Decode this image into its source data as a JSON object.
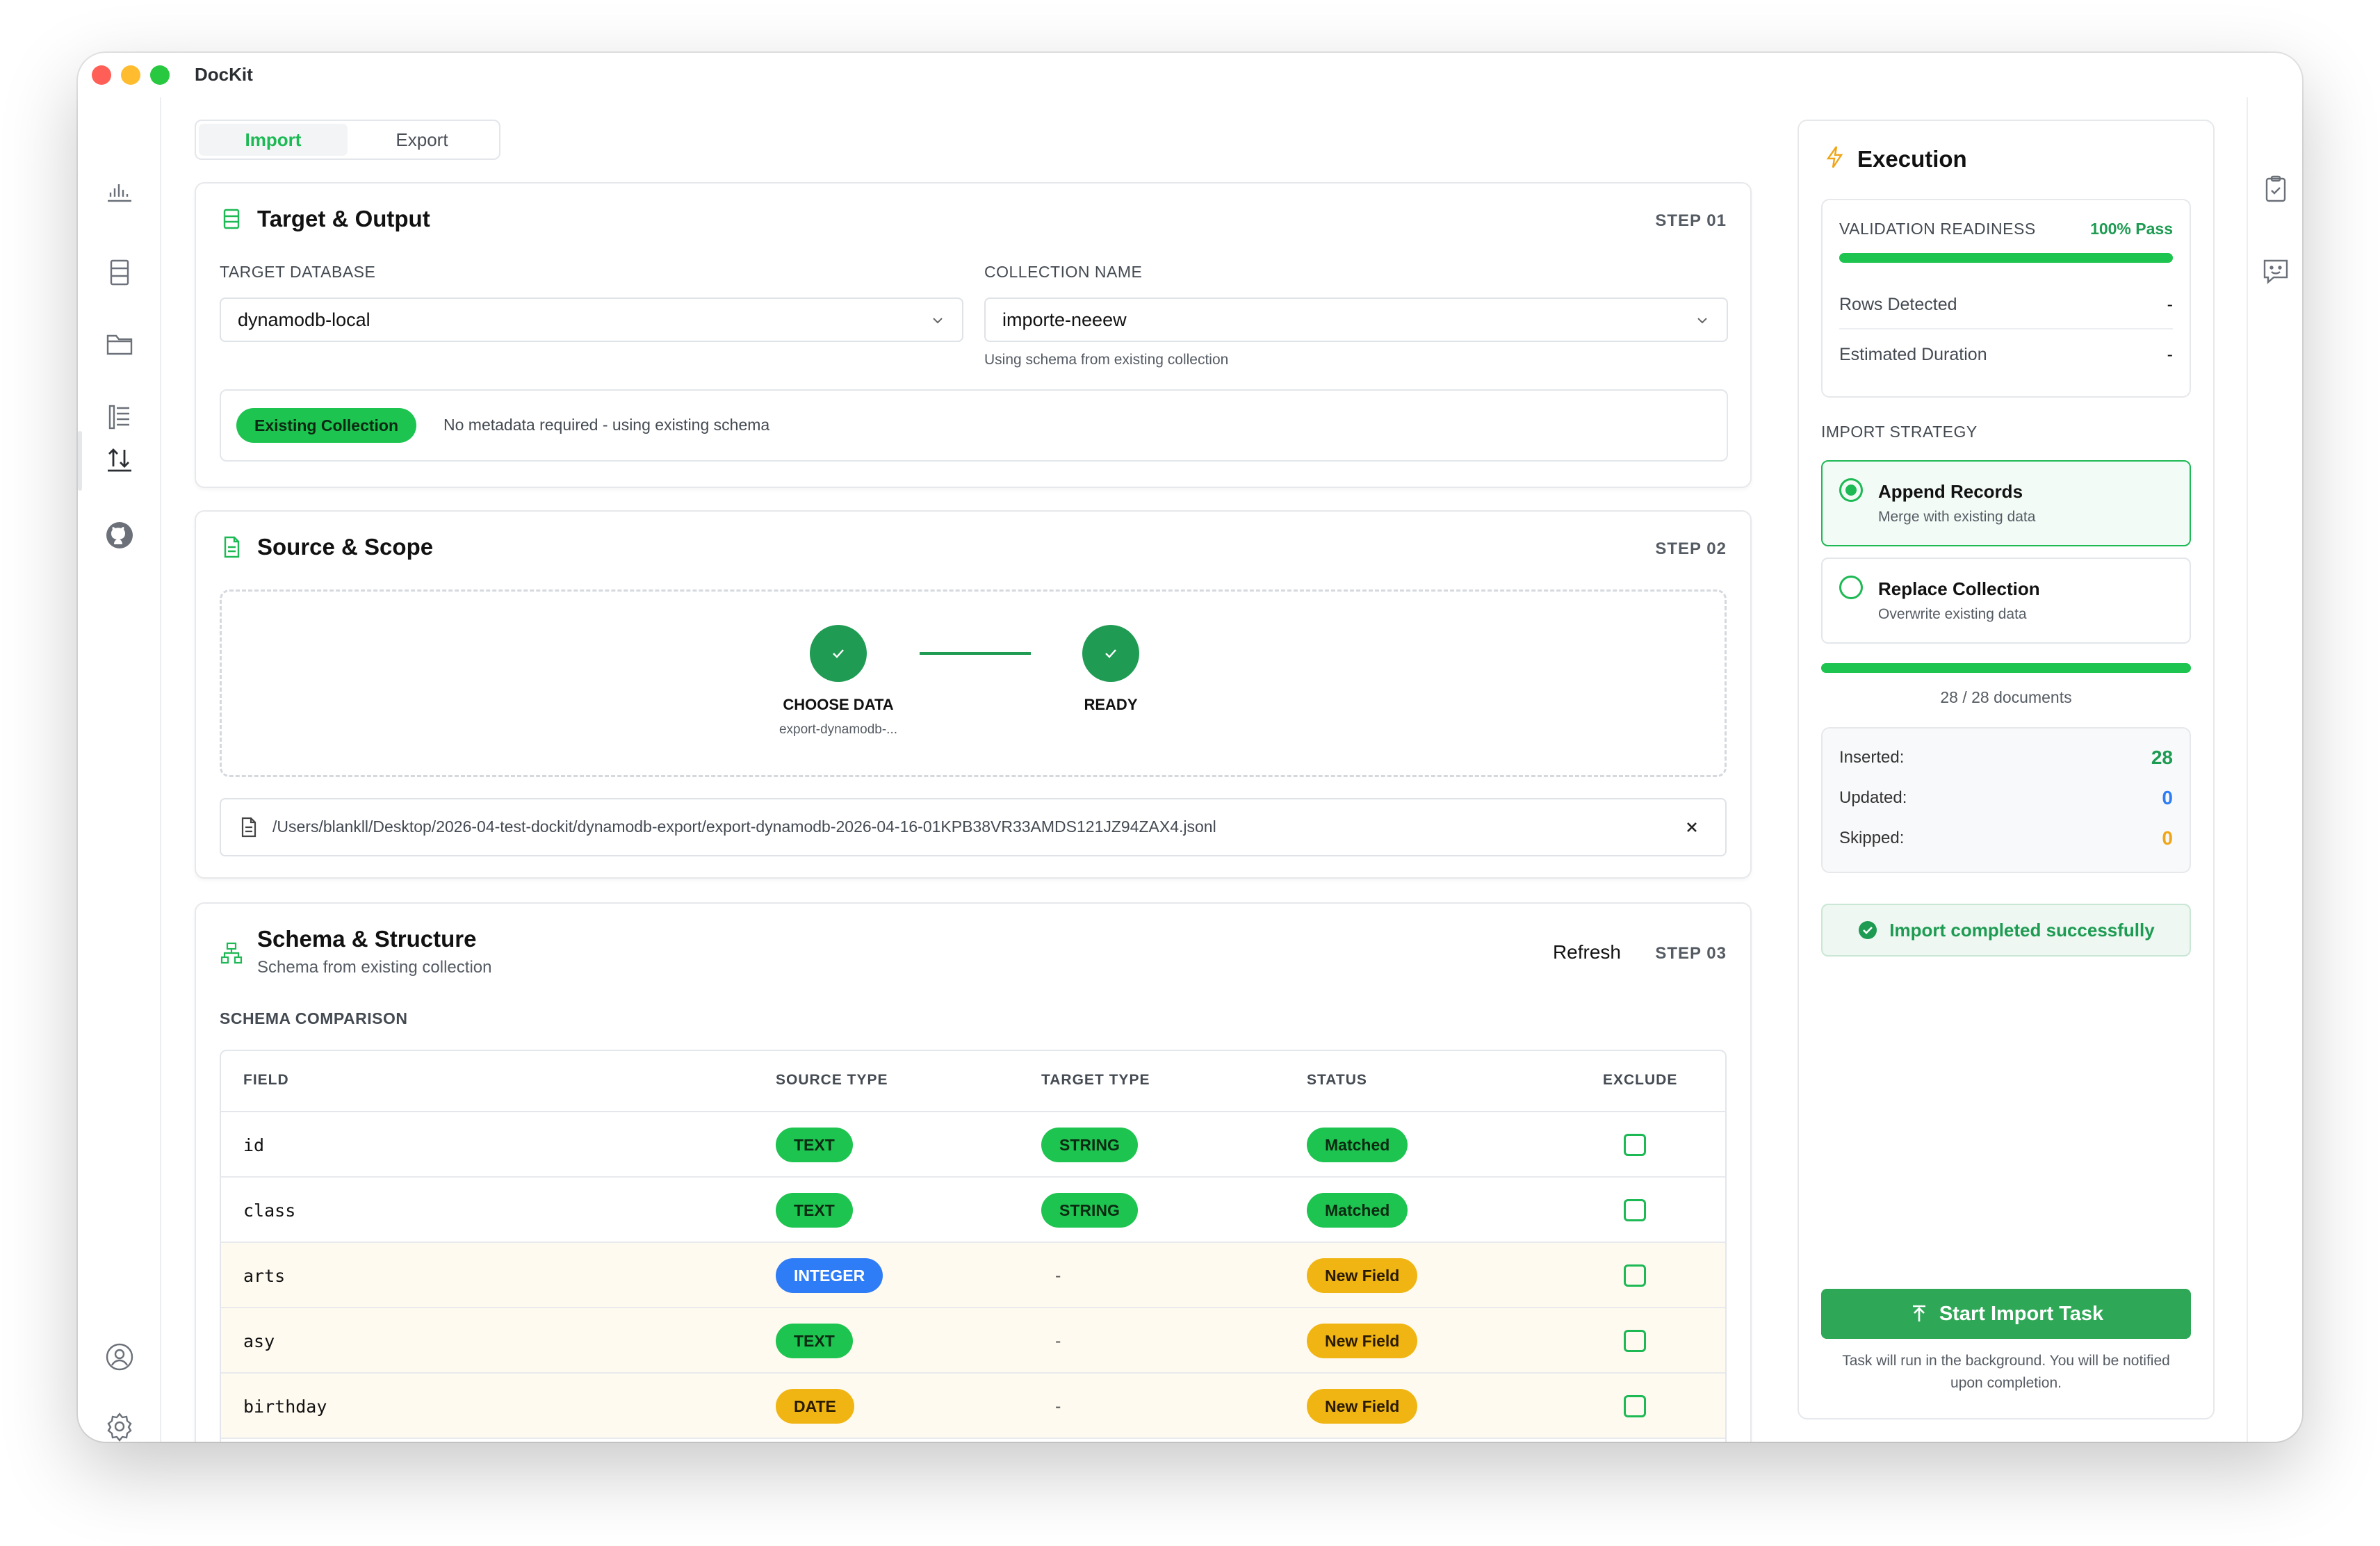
{
  "app": {
    "title": "DocKit"
  },
  "tabs": [
    {
      "label": "Import"
    },
    {
      "label": "Export"
    }
  ],
  "target": {
    "title": "Target & Output",
    "step": "STEP 01",
    "db_label": "TARGET DATABASE",
    "db_value": "dynamodb-local",
    "coll_label": "COLLECTION NAME",
    "coll_value": "importe-neeew",
    "coll_hint": "Using schema from existing collection",
    "badge": "Existing Collection",
    "badge_note": "No metadata required - using existing schema"
  },
  "source": {
    "title": "Source & Scope",
    "step": "STEP 02",
    "step1_label": "CHOOSE DATA",
    "step1_sub": "export-dynamodb-...",
    "step2_label": "READY",
    "file_path": "/Users/blankll/Desktop/2026-04-test-dockit/dynamodb-export/export-dynamodb-2026-04-16-01KPB38VR33AMDS121JZ94ZAX4.jsonl"
  },
  "schema": {
    "title": "Schema & Structure",
    "subtitle": "Schema from existing collection",
    "refresh": "Refresh",
    "step": "STEP 03",
    "comparison_label": "SCHEMA COMPARISON",
    "columns": [
      "FIELD",
      "SOURCE TYPE",
      "TARGET TYPE",
      "STATUS",
      "EXCLUDE"
    ],
    "rows": [
      {
        "field": "id",
        "source": "TEXT",
        "target": "STRING",
        "status": "Matched"
      },
      {
        "field": "class",
        "source": "TEXT",
        "target": "STRING",
        "status": "Matched"
      },
      {
        "field": "arts",
        "source": "INTEGER",
        "target": "-",
        "status": "New Field"
      },
      {
        "field": "asy",
        "source": "TEXT",
        "target": "-",
        "status": "New Field"
      },
      {
        "field": "birthday",
        "source": "DATE",
        "target": "-",
        "status": "New Field"
      }
    ]
  },
  "execution": {
    "title": "Execution",
    "readiness_label": "VALIDATION READINESS",
    "readiness_value": "100% Pass",
    "readiness_progress": 1.0,
    "rows_label": "Rows Detected",
    "rows_value": "-",
    "duration_label": "Estimated Duration",
    "duration_value": "-",
    "strategy_label": "IMPORT STRATEGY",
    "append_title": "Append Records",
    "append_desc": "Merge with existing data",
    "replace_title": "Replace Collection",
    "replace_desc": "Overwrite existing data",
    "docs_progress": 1.0,
    "docs_text": "28 / 28 documents",
    "inserted_label": "Inserted:",
    "inserted_value": "28",
    "updated_label": "Updated:",
    "updated_value": "0",
    "skipped_label": "Skipped:",
    "skipped_value": "0",
    "success_text": "Import completed successfully",
    "start_button": "Start Import Task",
    "footnote": "Task will run in the background. You will be notified upon completion."
  },
  "colors": {
    "accent": "#1db954",
    "blue": "#2f7df6",
    "yellow": "#f0b512"
  }
}
